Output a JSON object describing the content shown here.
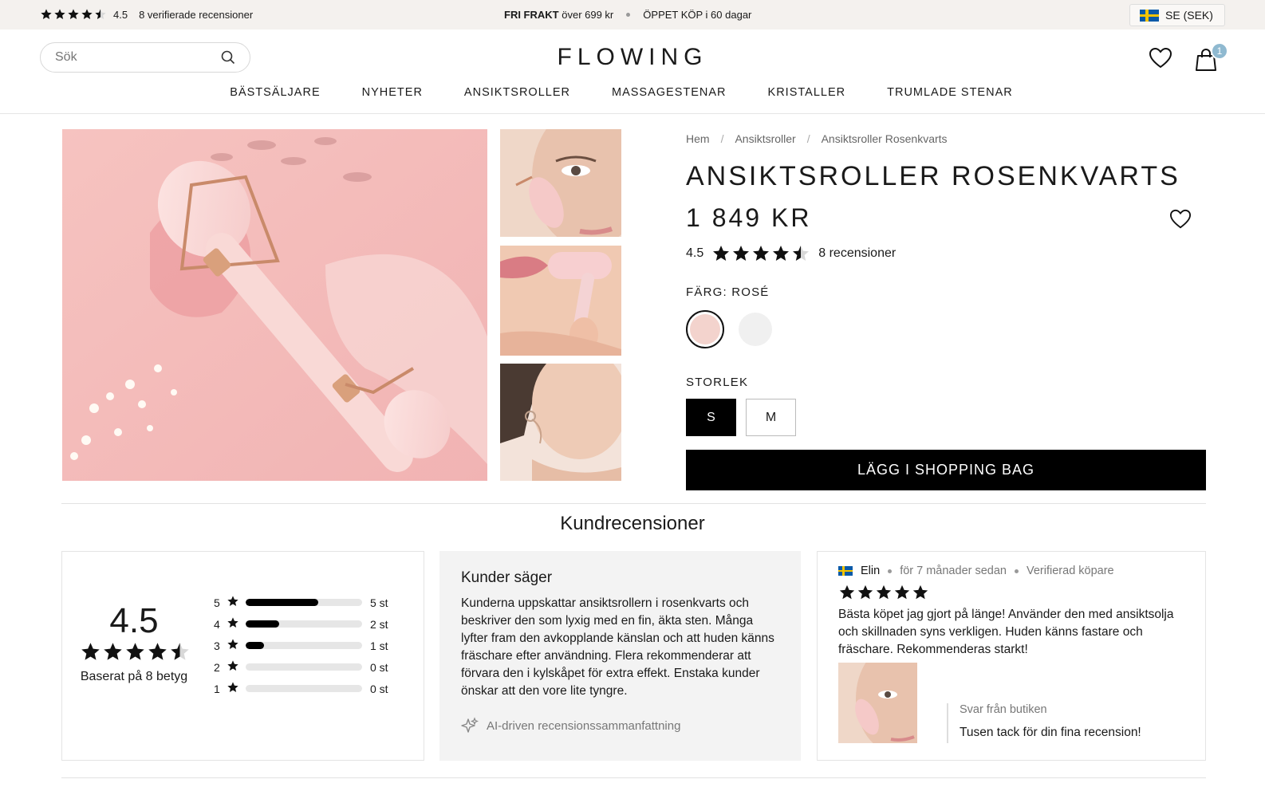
{
  "topbar": {
    "rating_value": "4.5",
    "rating_text": "8 verifierade recensioner",
    "free_shipping_bold": "FRI FRAKT",
    "free_shipping_rest": "över 699 kr",
    "open_purchase": "ÖPPET KÖP i 60 dagar",
    "locale": "SE (SEK)"
  },
  "header": {
    "search_placeholder": "Sök",
    "logo": "FLOWING",
    "cart_count": "1",
    "nav": [
      "BÄSTSÄLJARE",
      "NYHETER",
      "ANSIKTSROLLER",
      "MASSAGESTENAR",
      "KRISTALLER",
      "TRUMLADE STENAR"
    ]
  },
  "product": {
    "breadcrumbs": [
      "Hem",
      "Ansiktsroller",
      "Ansiktsroller Rosenkvarts"
    ],
    "title": "ANSIKTSROLLER ROSENKVARTS",
    "price": "1 849 KR",
    "rating_value": "4.5",
    "rating_score": 4.5,
    "reviews_link": "8 recensioner",
    "color_label": "FÄRG: ROSÉ",
    "swatch_colors": [
      "#f3d3cd",
      "#f0f0f0"
    ],
    "size_label": "STORLEK",
    "sizes": [
      "S",
      "M"
    ],
    "selected_size": "S",
    "add_to_bag": "LÄGG I SHOPPING BAG"
  },
  "reviews": {
    "heading": "Kundrecensioner",
    "summary": {
      "score": "4.5",
      "score_value": 4.5,
      "based_on": "Baserat på 8 betyg",
      "distribution": [
        {
          "stars": "5",
          "count": "5 st",
          "fraction": 0.625
        },
        {
          "stars": "4",
          "count": "2 st",
          "fraction": 0.29
        },
        {
          "stars": "3",
          "count": "1 st",
          "fraction": 0.16
        },
        {
          "stars": "2",
          "count": "0 st",
          "fraction": 0
        },
        {
          "stars": "1",
          "count": "0 st",
          "fraction": 0
        }
      ]
    },
    "ai_summary": {
      "title": "Kunder säger",
      "text": "Kunderna uppskattar ansiktsrollern i rosenkvarts och beskriver den som lyxig med en fin, äkta sten. Många lyfter fram den avkopplande känslan och att huden känns fräschare efter användning. Flera rekommenderar att förvara den i kylskåpet för extra effekt. Enstaka kunder önskar att den vore lite tyngre.",
      "footer": "AI-driven recensionssammanfattning"
    },
    "review": {
      "author": "Elin",
      "time": "för 7 månader sedan",
      "verified": "Verifierad köpare",
      "stars": 5,
      "text": "Bästa köpet jag gjort på länge! Använder den med ansiktsolja och skillnaden syns verkligen. Huden känns fastare och fräschare. Rekommenderas starkt!",
      "reply_from": "Svar från butiken",
      "reply_text": "Tusen tack för din fina recension!"
    }
  }
}
